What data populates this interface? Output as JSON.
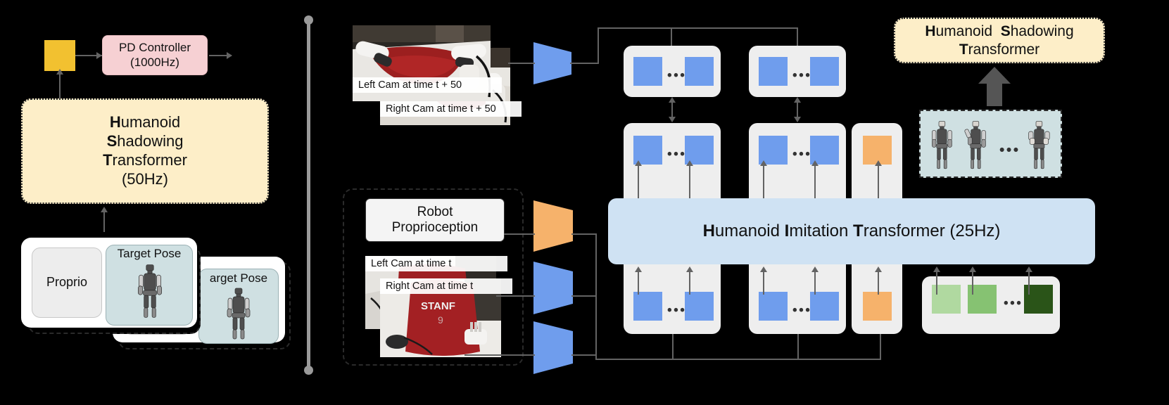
{
  "left_panel": {
    "pd_controller": {
      "line1": "PD Controller",
      "line2": "(1000Hz)"
    },
    "hst": {
      "line1_bold": "H",
      "line1_rest": "umanoid",
      "line2_bold": "S",
      "line2_rest": "hadowing",
      "line3_bold": "T",
      "line3_rest": "ransformer",
      "line4": "(50Hz)"
    },
    "proprio_label": "Proprio",
    "target_pose_label": "Target Pose",
    "target_pose_label_2": "arget Pose",
    "gold_block_name": "action-block"
  },
  "middle_panel": {
    "top_cams": [
      {
        "caption": "Left Cam at time t + 50"
      },
      {
        "caption": "Right Cam at time t + 50"
      }
    ],
    "proprio_box": {
      "line1": "Robot",
      "line2": "Proprioception"
    },
    "bottom_cams": [
      {
        "caption": "Left Cam at time t"
      },
      {
        "caption": "Right Cam at time t"
      }
    ]
  },
  "transformer": {
    "title_parts": [
      {
        "text": "H",
        "bold": true
      },
      {
        "text": "umanoid ",
        "bold": false
      },
      {
        "text": "I",
        "bold": true
      },
      {
        "text": "mitation ",
        "bold": false
      },
      {
        "text": "T",
        "bold": true
      },
      {
        "text": "ransformer (25Hz)",
        "bold": false
      }
    ],
    "title_plain": "Humanoid Imitation Transformer (25Hz)",
    "ellipsis": "•••"
  },
  "right_panel": {
    "hst_label": {
      "line1_a_bold": "H",
      "line1_a_rest": "umanoid",
      "line1_b_bold": "S",
      "line1_b_rest": "hadowing",
      "line2_bold": "T",
      "line2_rest": "ransformer"
    },
    "pose_ellipsis": "•••"
  },
  "colors": {
    "token_blue": "#6f9ded",
    "token_orange": "#f6b26b",
    "token_green_light": "#b0d9a0",
    "token_green_mid": "#86c272",
    "token_green_dark": "#2a5418",
    "hit_bar": "#cfe2f3",
    "hst_yellow": "#fdeec8",
    "pd_pink": "#f6d0d3",
    "gold": "#f2c130",
    "teal_band": "#cfe0e2",
    "panel_grey": "#eeeeee",
    "line_grey": "#636363"
  },
  "groups": {
    "upper_left_tokens": {
      "kind": "blue",
      "count": 2
    },
    "upper_right_tokens": {
      "kind": "blue",
      "count": 2
    },
    "mid_left_tokens": {
      "kind": "blue",
      "count": 2
    },
    "mid_right_tokens": {
      "kind": "blue",
      "count": 2
    },
    "mid_action_token": {
      "kind": "orange",
      "count": 1
    },
    "low_left_tokens": {
      "kind": "blue",
      "count": 2
    },
    "low_right_tokens": {
      "kind": "blue",
      "count": 2
    },
    "low_action_token": {
      "kind": "orange",
      "count": 1
    },
    "low_green_tokens": {
      "kind": "green",
      "count": 3
    }
  }
}
